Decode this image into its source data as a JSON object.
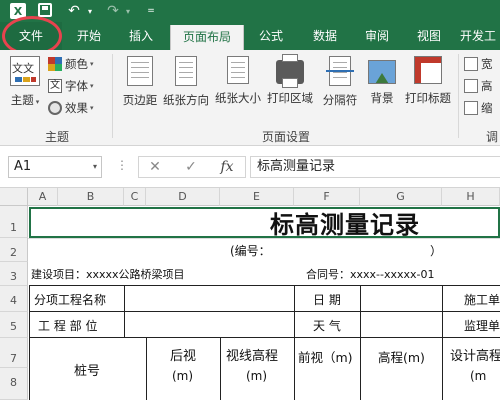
{
  "app": {
    "logo_letter": "X"
  },
  "qat": {
    "undo_glyph": "↶",
    "redo_glyph": "↷",
    "caret_glyph": "▾",
    "customize_glyph": "="
  },
  "tabs": [
    {
      "label": "文件"
    },
    {
      "label": "开始"
    },
    {
      "label": "插入"
    },
    {
      "label": "页面布局"
    },
    {
      "label": "公式"
    },
    {
      "label": "数据"
    },
    {
      "label": "审阅"
    },
    {
      "label": "视图"
    },
    {
      "label": "开发工"
    }
  ],
  "ribbon": {
    "themes_group": {
      "label": "主题",
      "theme_button": "主题",
      "icon_text": "文文",
      "colors": "颜色",
      "fonts": "字体",
      "effects": "效果"
    },
    "page_setup_group": {
      "label": "页面设置",
      "buttons": [
        "页边距",
        "纸张方向",
        "纸张大小",
        "打印区域",
        "分隔符",
        "背景",
        "打印标题"
      ]
    },
    "scale_group": {
      "label": "调",
      "items": [
        "宽",
        "高",
        "缩"
      ]
    }
  },
  "formula_bar": {
    "name_box": "A1",
    "dots": "⋮",
    "cancel_glyph": "✕",
    "enter_glyph": "✓",
    "fx_glyph": "fx",
    "content": "标高测量记录"
  },
  "sheet": {
    "columns": [
      "A",
      "B",
      "C",
      "D",
      "E",
      "F",
      "G",
      "H"
    ],
    "rows": [
      "1",
      "2",
      "3",
      "4",
      "5",
      "7",
      "8"
    ],
    "title": "标高测量记录",
    "number_open": "(编号：",
    "number_close": "）",
    "project_label": "建设项目：xxxxx公路桥梁项目",
    "contract_label": "合同号：xxxx--xxxxx-01",
    "subproject_label": "分项工程名称",
    "date_label": "日  期",
    "construction_unit": "施工单",
    "location_label": "工  程  部  位",
    "weather_label": "天  气",
    "supervision_unit": "监理单",
    "station_label": "桩号",
    "backsight_label": "后视",
    "backsight_unit": "(m)",
    "hi_label": "视线高程",
    "hi_unit": "(m)",
    "foresight_label": "前视（m)",
    "elevation_label": "高程(m)",
    "design_label": "设计高程",
    "design_unit": "(m"
  }
}
